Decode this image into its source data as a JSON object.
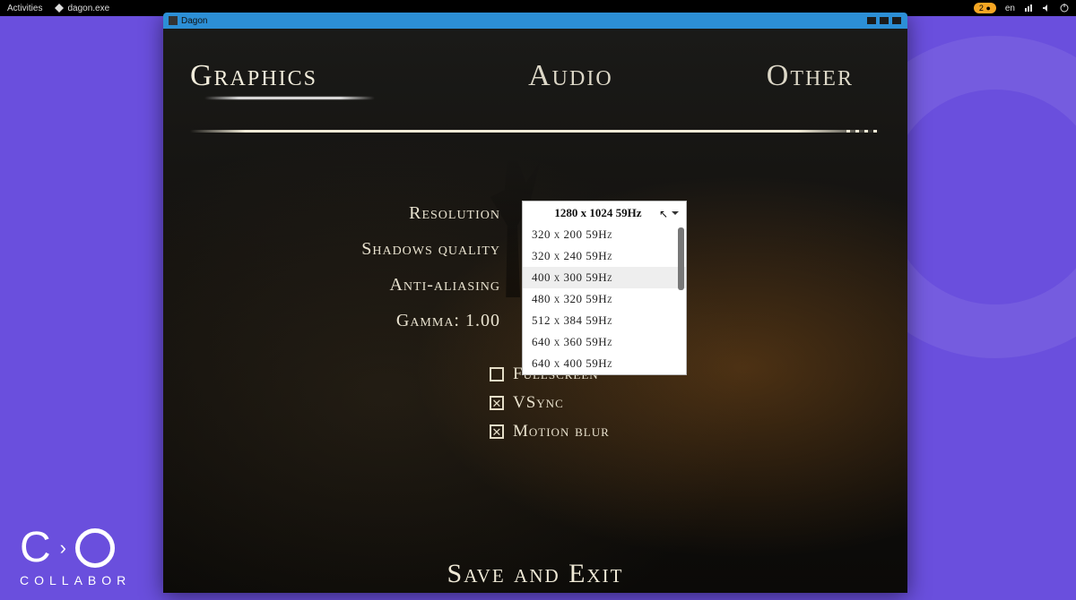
{
  "topbar": {
    "activities": "Activities",
    "app_name": "dagon.exe",
    "lang": "en",
    "pill": "2"
  },
  "window": {
    "title": "Dagon"
  },
  "tabs": {
    "graphics": "Graphics",
    "audio": "Audio",
    "other": "Other",
    "active": "graphics"
  },
  "settings": {
    "resolution_label": "Resolution",
    "shadows_label": "Shadows quality",
    "aa_label": "Anti-aliasing",
    "gamma_label": "Gamma: 1.00"
  },
  "resolution": {
    "selected": "1280 x 1024 59Hz",
    "options": [
      "320 x 200 59Hz",
      "320 x 240 59Hz",
      "400 x 300 59Hz",
      "480 x 320 59Hz",
      "512 x 384 59Hz",
      "640 x 360 59Hz",
      "640 x 400 59Hz"
    ]
  },
  "checkboxes": {
    "fullscreen": {
      "label": "Fullscreen",
      "checked": false
    },
    "vsync": {
      "label": "VSync",
      "checked": true
    },
    "motionblur": {
      "label": "Motion blur",
      "checked": true
    }
  },
  "save_exit": "Save and Exit",
  "brand": {
    "text": "COLLABOR"
  }
}
